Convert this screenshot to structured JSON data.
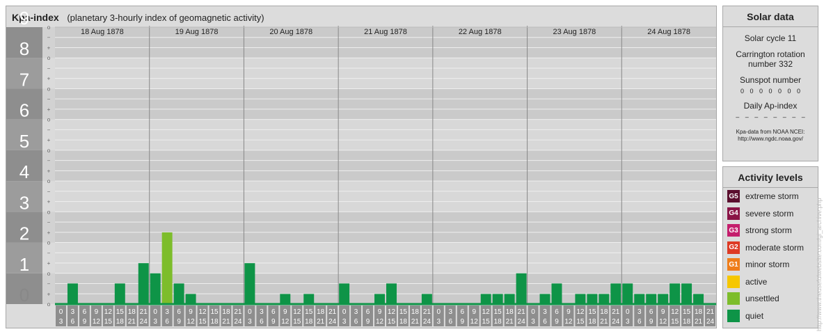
{
  "header": {
    "title": "Kpa-index",
    "subtitle": "(planetary 3-hourly index of geomagnetic activity)"
  },
  "chart_data": {
    "type": "bar",
    "ylim": [
      0,
      9
    ],
    "y_major_ticks": [
      "0",
      "1",
      "2",
      "3",
      "4",
      "5",
      "6",
      "7",
      "8",
      "9"
    ],
    "y_minor_ticks": [
      "o",
      "+",
      "−"
    ],
    "days": [
      "18 Aug 1878",
      "19 Aug 1878",
      "20 Aug 1878",
      "21 Aug 1878",
      "22 Aug 1878",
      "23 Aug 1878",
      "24 Aug 1878"
    ],
    "interval_starts": [
      "0",
      "3",
      "6",
      "9",
      "12",
      "15",
      "18",
      "21"
    ],
    "interval_ends": [
      "3",
      "6",
      "9",
      "12",
      "15",
      "18",
      "21",
      "24"
    ],
    "series": [
      {
        "values": [
          0,
          0.67,
          0,
          0,
          0,
          0.67,
          0,
          1.33,
          1,
          2.33,
          0.67,
          0.33,
          0,
          0,
          0,
          0,
          1.33,
          0,
          0,
          0.33,
          0,
          0.33,
          0,
          0,
          0.67,
          0,
          0,
          0.33,
          0.67,
          0,
          0,
          0.33,
          0,
          0,
          0,
          0,
          0.33,
          0.33,
          0.33,
          1,
          0,
          0.33,
          0.67,
          0,
          0.33,
          0.33,
          0.33,
          0.67,
          0.67,
          0.33,
          0.33,
          0.33,
          0.67,
          0.67,
          0.33,
          0
        ]
      }
    ],
    "colors": {
      "quiet": "#0e9447",
      "unsettled": "#7dbd2b"
    }
  },
  "solar": {
    "title": "Solar data",
    "cycle": "Solar cycle 11",
    "carrington_1": "Carrington rotation",
    "carrington_2": "number 332",
    "sunspot_label": "Sunspot number",
    "sunspot_values": "0 0 0 0 0 0 0",
    "ap_label": "Daily Ap-index",
    "ap_values": "– – – – – – – –",
    "source_1": "Kpa-data from NOAA NCEI:",
    "source_2": "http://www.ngdc.noaa.gov/"
  },
  "activity": {
    "title": "Activity levels",
    "items": [
      {
        "badge": "G5",
        "label": "extreme storm",
        "color": "#5b0f2e"
      },
      {
        "badge": "G4",
        "label": "severe storm",
        "color": "#8a1446"
      },
      {
        "badge": "G3",
        "label": "strong storm",
        "color": "#c41e6c"
      },
      {
        "badge": "G2",
        "label": "moderate storm",
        "color": "#de3a24"
      },
      {
        "badge": "G1",
        "label": "minor storm",
        "color": "#ef7d1a"
      },
      {
        "badge": "",
        "label": "active",
        "color": "#f6c700"
      },
      {
        "badge": "",
        "label": "unsettled",
        "color": "#7dbd2b"
      },
      {
        "badge": "",
        "label": "quiet",
        "color": "#0e9447"
      }
    ]
  },
  "watermark": "http://www.theusefulwebsite.com/gi_archive.php"
}
